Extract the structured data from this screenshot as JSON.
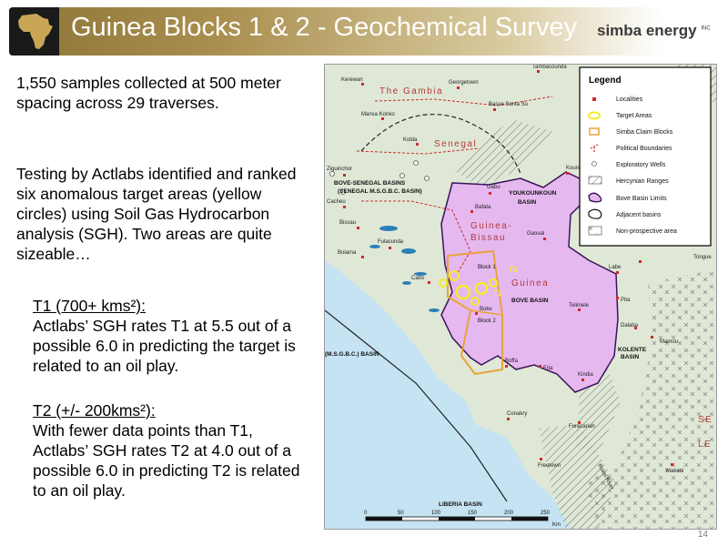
{
  "header": {
    "title": "Guinea Blocks 1 & 2 - Geochemical Survey",
    "brand": "simba energy",
    "brand_suffix": "INC"
  },
  "body": {
    "intro": "1,550 samples collected at 500 meter spacing across 29 traverses.",
    "testing": "Testing by Actlabs identified and ranked six anomalous target areas (yellow circles) using Soil Gas Hydrocarbon analysis (SGH).  Two areas are quite sizeable…",
    "t1_heading": "T1 (700+ kms²):",
    "t1_text": "Actlabs’ SGH rates T1 at 5.5 out of a possible 6.0 in predicting the target is related to an oil play.",
    "t2_heading": "T2 (+/- 200kms²):",
    "t2_text": "With fewer data points than T1, Actlabs’ SGH rates T2 at 4.0 out of a possible 6.0 in predicting T2 is related to an oil play."
  },
  "page_number": "14",
  "colors": {
    "sea": "#c5e3f2",
    "land": "#dfe8d6",
    "bove_basin": "#e6b8f0",
    "claim_blocks": "#e8a33b",
    "target_areas": "#f4ec2a",
    "localities": "#d22a2a",
    "political_boundaries": "#cc2b2b"
  },
  "map": {
    "legend": {
      "title": "Legend",
      "items": [
        {
          "label": "Localities",
          "icon": "red-dot-icon"
        },
        {
          "label": "Target Areas",
          "icon": "yellow-circle-icon"
        },
        {
          "label": "Simba Claim Blocks",
          "icon": "orange-square-icon"
        },
        {
          "label": "Political Boundaries",
          "icon": "red-dashed-line-icon"
        },
        {
          "label": "Exploratory Wells",
          "icon": "well-circle-icon"
        },
        {
          "label": "Hercynian Ranges",
          "icon": "hatched-area-icon"
        },
        {
          "label": "Bove Basin Limits",
          "icon": "purple-outline-icon"
        },
        {
          "label": "Adjacent basins",
          "icon": "black-outline-icon"
        },
        {
          "label": "Non-prospective area",
          "icon": "crosses-area-icon"
        }
      ]
    },
    "countries": [
      "The Gambia",
      "Senegal",
      "Guinea-",
      "Bissau",
      "Guinea",
      "SE",
      "LE"
    ],
    "basins": [
      "BOVE-SENEGAL BASINS",
      "(SENEGAL M.S.G.B.C. BASIN)",
      "YOUKOUNKOUN",
      "BASIN",
      "BOVE BASIN",
      "KOLENTE",
      "BASIN",
      "LIBERIA BASIN",
      "(M.S.G.B.C.) BASIN"
    ],
    "blocks": [
      "Block 1",
      "Block 2"
    ],
    "targets": [
      "T1",
      "T2"
    ],
    "localities": [
      "Tambacounda",
      "Kerewan",
      "Georgetown",
      "Basse Santa Su",
      "Mansa Konko",
      "Kolda",
      "Ziguinchor",
      "Cacheu",
      "Bissau",
      "Bafata",
      "Gabu",
      "Bolama",
      "Fulacunda",
      "Catio",
      "Boke",
      "Gaoual",
      "Koundara",
      "Labe",
      "Tongue",
      "Pita",
      "Telimele",
      "Dalaba",
      "Mamou",
      "Fria",
      "Boffa",
      "Kindia",
      "Conakry",
      "Forecariah",
      "Makeni",
      "Freetown"
    ],
    "rivers": [
      "Rokel River"
    ],
    "scale_ticks": [
      "0",
      "50",
      "100",
      "150",
      "200",
      "250"
    ],
    "scale_unit": "Km"
  }
}
